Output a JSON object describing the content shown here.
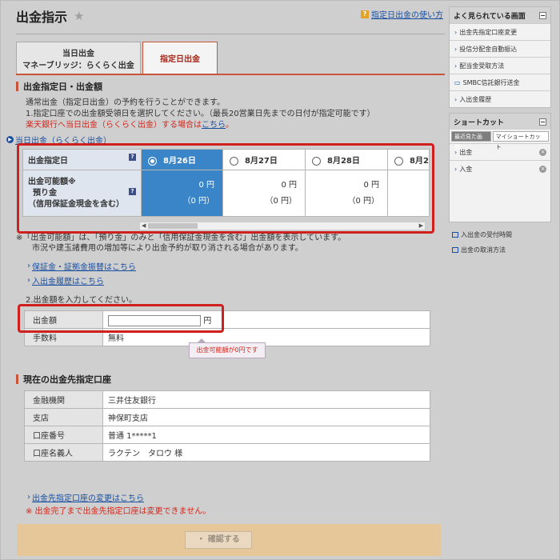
{
  "page": {
    "title": "出金指示",
    "guide_link": "指定日出金の使い方"
  },
  "tabs": [
    {
      "line1": "当日出金",
      "line2": "マネーブリッジ：らくらく出金"
    },
    {
      "line1": "指定日出金",
      "line2": ""
    }
  ],
  "section1": {
    "heading": "出金指定日・出金額",
    "intro1": "通常出金（指定日出金）の予約を行うことができます。",
    "intro2": "1.指定口座での出金額受領日を選択してください。（最長20営業日先までの日付が指定可能です）",
    "red_note": "楽天銀行へ当日出金（らくらく出金）する場合は",
    "red_note_link": "こちら",
    "same_day_link": "当日出金（らくらく出金）"
  },
  "schedule": {
    "date_header": "出金指定日",
    "amount_header_1": "出金可能額※",
    "amount_header_2": "預り金",
    "amount_header_3": "（信用保証金現金を含む）",
    "dates": [
      {
        "label": "8月26日",
        "amount": "0 円",
        "deposit": "（0 円）",
        "selected": true
      },
      {
        "label": "8月27日",
        "amount": "0 円",
        "deposit": "（0 円）",
        "selected": false
      },
      {
        "label": "8月28日",
        "amount": "0 円",
        "deposit": "（0 円）",
        "selected": false
      },
      {
        "label": "8月2",
        "amount": "",
        "deposit": "",
        "selected": false
      }
    ]
  },
  "notes": {
    "note1": "※「出金可能額」は、「預り金」のみと「信用保証金現金を含む」出金額を表示しています。",
    "note2": "市況や建玉諸費用の増加等により出金予約が取り消される場合があります。",
    "link1": "保証金・証拠金振替はこちら",
    "link2": "入出金履歴はこちら",
    "step2": "2.出金額を入力してください。"
  },
  "amount_form": {
    "label": "出金額",
    "value": "",
    "unit": "円",
    "fee_label": "手数料",
    "fee_value": "無料",
    "tooltip": "出金可能額が0円です"
  },
  "section2": {
    "heading": "現在の出金先指定口座",
    "rows": [
      {
        "label": "金融機関",
        "value": "三井住友銀行"
      },
      {
        "label": "支店",
        "value": "神保町支店"
      },
      {
        "label": "口座番号",
        "value": "普通 1*****1"
      },
      {
        "label": "口座名義人",
        "value": "ラクテン　タロウ 様"
      }
    ],
    "change_link": "出金先指定口座の変更はこちら",
    "warn": "※ 出金完了まで出金先指定口座は変更できません。"
  },
  "confirm_label": "・ 確認する",
  "sidebar": {
    "popular_title": "よく見られている画面",
    "popular_items": [
      "出金先指定口座変更",
      "投信分配金自動振込",
      "配当金受取方法",
      "SMBC信託銀行送金",
      "入出金履歴"
    ],
    "shortcut_title": "ショートカット",
    "shortcut_tabs": [
      "最近見た画面",
      "マイショートカット"
    ],
    "shortcut_items": [
      "出金",
      "入金"
    ],
    "links": [
      "入出金の受付時間",
      "出金の取消方法"
    ]
  }
}
